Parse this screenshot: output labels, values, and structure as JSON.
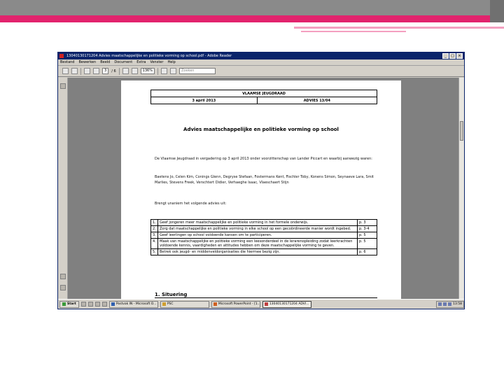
{
  "window": {
    "title": "13040130171204 Advies maatschappelijke en politieke vorming op school.pdf - Adobe Reader",
    "controls": {
      "minimize": "_",
      "maximize": "□",
      "close": "×"
    }
  },
  "menu": [
    "Bestand",
    "Bewerken",
    "Beeld",
    "Document",
    "Extra",
    "Venster",
    "Help"
  ],
  "toolbar": {
    "page_current": "3",
    "page_total": "/ 6",
    "zoom": "136%",
    "search_placeholder": "Zoeken"
  },
  "document": {
    "header": {
      "org": "VLAAMSE JEUGDRAAD",
      "date": "3 april 2013",
      "advice": "ADVIES 13/04"
    },
    "title": "Advies maatschappelijke en politieke vorming op school",
    "intro": "De Vlaamse Jeugdraad in vergadering op 3 april 2013 onder voorzitterschap van Lander Piccart en waarbij aanwezig waren:",
    "attendees": "Baetens Jo, Celen Kim, Conings Glenn, Degryse Stefaan, Fostermans Kent, Fischler Toby, Konens Simon, Seynaeve Lara, Smit Marlies, Stevens Freek, Verschtert Didier, Verhaeghe Isaac, Vlaeschaert Stijn",
    "lead": "Brengt unaniem het volgende advies uit:",
    "toc": [
      {
        "num": "1.",
        "text": "Geef jongeren meer maatschappelijke en politieke vorming in het formele onderwijs.",
        "page": "p. 3"
      },
      {
        "num": "2.",
        "text": "Zorg dat maatschappelijke en politieke vorming in elke school op een gecoördineerde manier wordt ingebed.",
        "page": "p. 3-4"
      },
      {
        "num": "3.",
        "text": "Geef leerlingen op school voldoende kansen om te participeren.",
        "page": "p. 5"
      },
      {
        "num": "4.",
        "text": "Maak van maatschappelijke en politieke vorming een leesonderdeel in de lerarenopleiding zodat leerkrachten voldoende kennis, vaardigheden en attitudes hebben om deze maatschappelijke vorming te geven.",
        "page": "p. 5"
      },
      {
        "num": "5.",
        "text": "Betrek ook jeugd- en middenveldorganisaties die hiermee bezig zijn.",
        "page": "p. 6"
      }
    ],
    "section_heading": "1. Situering"
  },
  "taskbar": {
    "start_label": "Start",
    "tasks": [
      {
        "label": "Postvak IN - Microsoft O...",
        "active": false
      },
      {
        "label": "PSC",
        "active": false
      },
      {
        "label": "Microsoft PowerPoint - [1...",
        "active": false
      },
      {
        "label": "13040130171204 ADVI...",
        "active": true
      }
    ],
    "clock": "13:58"
  },
  "colors": {
    "accent_pink": "#e2236d",
    "title_bar": "#0a246a"
  }
}
